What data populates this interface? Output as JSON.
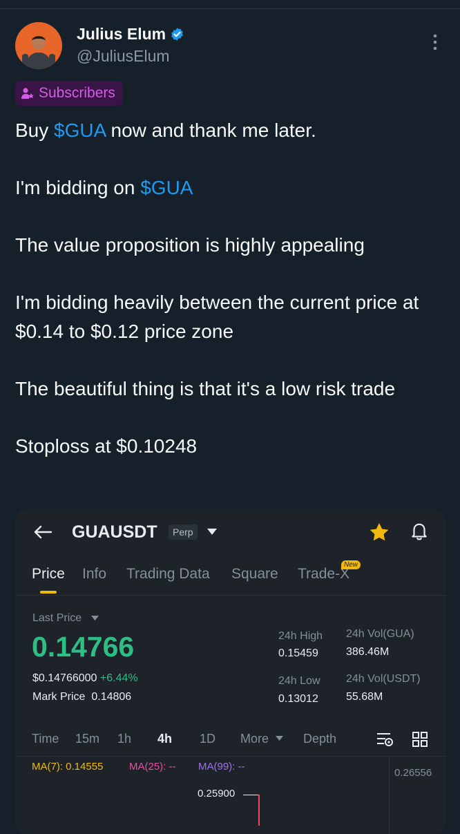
{
  "tweet": {
    "author_name": "Julius Elum",
    "author_handle": "@JuliusElum",
    "badge": "Subscribers",
    "lines": {
      "l1_pre": "Buy ",
      "l1_cash": "$GUA",
      "l1_post": " now and thank me later.",
      "l2_pre": "I'm bidding on ",
      "l2_cash": "$GUA",
      "l3": "The value proposition is highly appealing",
      "l4": "I'm bidding heavily between the current price at $0.14 to $0.12 price zone",
      "l5": "The beautiful thing is that it's a low risk trade",
      "l6": "Stoploss at $0.10248"
    }
  },
  "trading": {
    "symbol": "GUAUSDT",
    "contract_badge": "Perp",
    "tabs": [
      "Price",
      "Info",
      "Trading Data",
      "Square",
      "Trade-X"
    ],
    "tab_new_badge": "New",
    "active_tab": "Price",
    "last_price_label": "Last Price",
    "last_price": "0.14766",
    "usd_price": "$0.14766000",
    "change_pct": "+6.44%",
    "mark_price_label": "Mark Price",
    "mark_price": "0.14806",
    "high_label": "24h High",
    "high_value": "0.15459",
    "low_label": "24h Low",
    "low_value": "0.13012",
    "vol_gua_label": "24h Vol(GUA)",
    "vol_gua_value": "386.46M",
    "vol_usdt_label": "24h Vol(USDT)",
    "vol_usdt_value": "55.68M",
    "intervals": [
      "Time",
      "15m",
      "1h",
      "4h",
      "1D"
    ],
    "active_interval": "4h",
    "more_label": "More",
    "depth_label": "Depth",
    "ma7": "MA(7): 0.14555",
    "ma25": "MA(25): --",
    "ma99": "MA(99): --",
    "axis_top": "0.26556",
    "chart_high_label": "0.25900",
    "colors": {
      "accent": "#f0b90b",
      "positive": "#2ebd85",
      "candle_down": "#f6465d",
      "cashtag": "#1d9bf0",
      "badge": "#d35de6"
    }
  }
}
